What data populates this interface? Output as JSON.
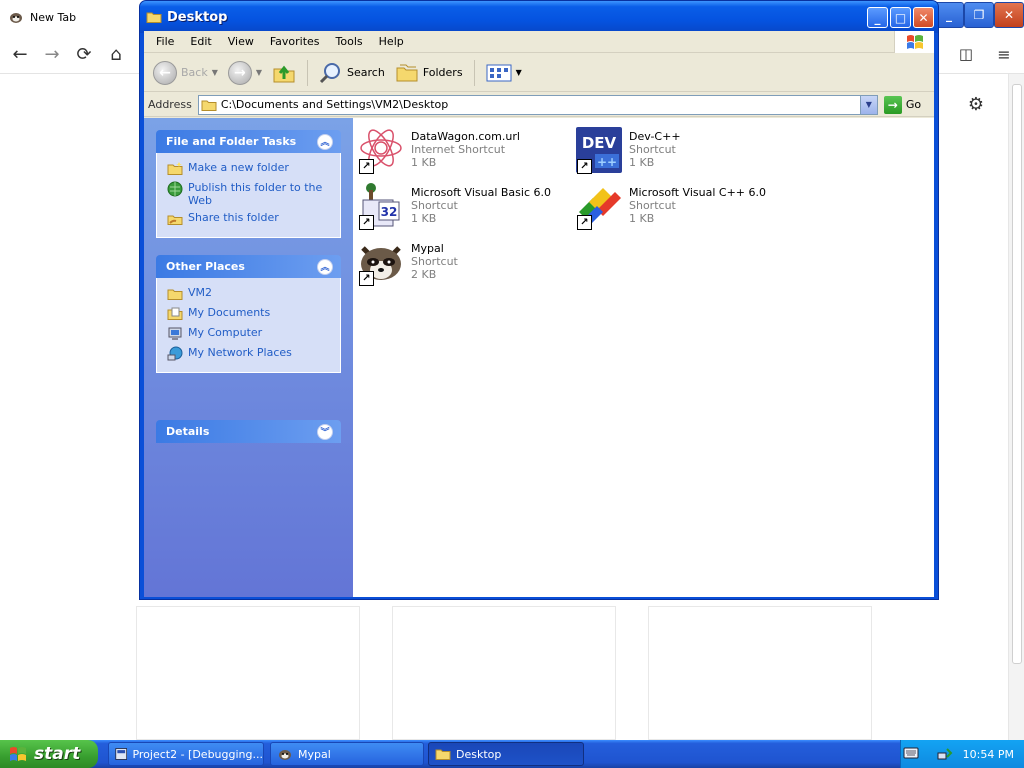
{
  "browser": {
    "tab_title": "New Tab"
  },
  "window": {
    "title": "Desktop",
    "menu": [
      "File",
      "Edit",
      "View",
      "Favorites",
      "Tools",
      "Help"
    ],
    "toolbar": {
      "back": "Back",
      "search": "Search",
      "folders": "Folders"
    },
    "address": {
      "label": "Address",
      "value": "C:\\Documents and Settings\\VM2\\Desktop",
      "go": "Go"
    }
  },
  "sidebar": {
    "tasks": {
      "title": "File and Folder Tasks",
      "items": [
        "Make a new folder",
        "Publish this folder to the Web",
        "Share this folder"
      ]
    },
    "places": {
      "title": "Other Places",
      "items": [
        "VM2",
        "My Documents",
        "My Computer",
        "My Network Places"
      ]
    },
    "details": {
      "title": "Details"
    }
  },
  "files": [
    {
      "name": "DataWagon.com.url",
      "type": "Internet Shortcut",
      "size": "1 KB"
    },
    {
      "name": "Dev-C++",
      "type": "Shortcut",
      "size": "1 KB"
    },
    {
      "name": "Microsoft Visual Basic 6.0",
      "type": "Shortcut",
      "size": "1 KB"
    },
    {
      "name": "Microsoft Visual C++ 6.0",
      "type": "Shortcut",
      "size": "1 KB"
    },
    {
      "name": "Mypal",
      "type": "Shortcut",
      "size": "2 KB"
    }
  ],
  "taskbar": {
    "start": "start",
    "tasks": [
      "Project2 - [Debugging...",
      "Mypal",
      "Desktop"
    ],
    "clock": "10:54 PM"
  }
}
